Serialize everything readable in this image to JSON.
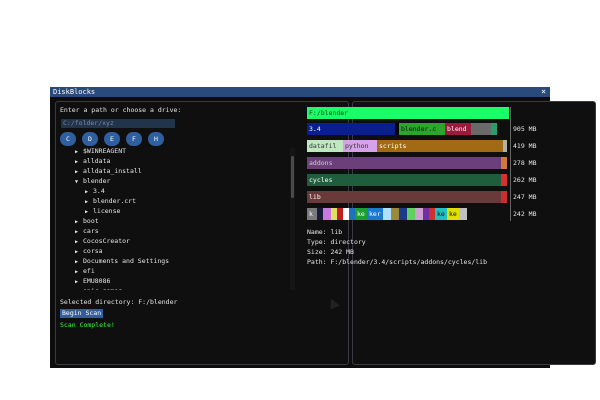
{
  "window": {
    "title": "DiskBlocks",
    "close": "×"
  },
  "left": {
    "prompt": "Enter a path or choose a drive:",
    "path_placeholder": "C:/folder/xyz",
    "drives": [
      "C",
      "D",
      "E",
      "F",
      "H"
    ],
    "tree": [
      {
        "label": "$WINREAGENT",
        "depth": 0,
        "expanded": false
      },
      {
        "label": "alldata",
        "depth": 0,
        "expanded": false
      },
      {
        "label": "alldata_install",
        "depth": 0,
        "expanded": false
      },
      {
        "label": "blender",
        "depth": 0,
        "expanded": true
      },
      {
        "label": "3.4",
        "depth": 1,
        "expanded": false
      },
      {
        "label": "blender.crt",
        "depth": 1,
        "expanded": false
      },
      {
        "label": "license",
        "depth": 1,
        "expanded": false
      },
      {
        "label": "boot",
        "depth": 0,
        "expanded": false
      },
      {
        "label": "cars",
        "depth": 0,
        "expanded": false
      },
      {
        "label": "CocosCreator",
        "depth": 0,
        "expanded": false
      },
      {
        "label": "corsa",
        "depth": 0,
        "expanded": false
      },
      {
        "label": "Documents and Settings",
        "depth": 0,
        "expanded": false
      },
      {
        "label": "efi",
        "depth": 0,
        "expanded": false
      },
      {
        "label": "EMU8086",
        "depth": 0,
        "expanded": false
      },
      {
        "label": "epic games",
        "depth": 0,
        "expanded": false
      }
    ],
    "selected": "Selected directory: F:/blender",
    "begin": "Begin Scan",
    "status": "Scan Complete!"
  },
  "right": {
    "root": "F:/blender",
    "rows": [
      {
        "size": "905 MB",
        "segments": [
          {
            "label": "3.4",
            "color": "#0a1f8f",
            "text": "#ffffff",
            "w": 88
          },
          {
            "label": "",
            "color": "#000000",
            "w": 4
          },
          {
            "label": "blender.c",
            "color": "#2aa62a",
            "text": "#111111",
            "w": 46
          },
          {
            "label": "blend",
            "color": "#9b1b3c",
            "text": "#ffffff",
            "w": 26
          },
          {
            "label": "",
            "color": "#6a6a6a",
            "w": 20
          },
          {
            "label": "",
            "color": "#2b9b6b",
            "w": 6
          }
        ]
      },
      {
        "size": "419 MB",
        "segments": [
          {
            "label": "datafil",
            "color": "#bfe7c0",
            "text": "#333333",
            "w": 36
          },
          {
            "label": "python",
            "color": "#d6a2e8",
            "text": "#333333",
            "w": 34
          },
          {
            "label": "scripts",
            "color": "#a36a16",
            "text": "#ffffff",
            "w": 126
          },
          {
            "label": "",
            "color": "#b0b0b0",
            "w": 4
          }
        ]
      },
      {
        "size": "278 MB",
        "segments": [
          {
            "label": "addons",
            "color": "#6a3f7a",
            "text": "#cfcfcf",
            "w": 194
          },
          {
            "label": "",
            "color": "#d07a3a",
            "w": 6
          }
        ]
      },
      {
        "size": "262 MB",
        "segments": [
          {
            "label": "cycles",
            "color": "#1e5e3c",
            "text": "#ffffff",
            "w": 194
          },
          {
            "label": "",
            "color": "#d83030",
            "w": 6
          }
        ]
      },
      {
        "size": "247 MB",
        "segments": [
          {
            "label": "lib",
            "color": "#6a3a3a",
            "text": "#ffffff",
            "w": 194
          },
          {
            "label": "",
            "color": "#c83030",
            "w": 6
          }
        ]
      },
      {
        "size": "242 MB",
        "segments": [
          {
            "label": "k",
            "color": "#7a7a7a",
            "text": "#ffffff",
            "w": 10
          },
          {
            "label": "",
            "color": "#1a1a3a",
            "w": 6
          },
          {
            "label": "",
            "color": "#c87ae0",
            "w": 8
          },
          {
            "label": "",
            "color": "#e0e060",
            "w": 6
          },
          {
            "label": "",
            "color": "#c02020",
            "w": 6
          },
          {
            "label": "",
            "color": "#ffffff",
            "w": 6
          },
          {
            "label": "",
            "color": "#2070c0",
            "w": 6
          },
          {
            "label": "ke",
            "color": "#1aa030",
            "text": "#ffffff",
            "w": 12
          },
          {
            "label": "ker",
            "color": "#1a7ad0",
            "text": "#ffffff",
            "w": 16
          },
          {
            "label": "",
            "color": "#b0e0ff",
            "w": 8
          },
          {
            "label": "",
            "color": "#9a8a3a",
            "w": 8
          },
          {
            "label": "",
            "color": "#1a3a8a",
            "w": 8
          },
          {
            "label": "",
            "color": "#60d060",
            "w": 8
          },
          {
            "label": "",
            "color": "#d0a0d0",
            "w": 8
          },
          {
            "label": "",
            "color": "#7030a0",
            "w": 6
          },
          {
            "label": "",
            "color": "#d03030",
            "w": 6
          },
          {
            "label": "ke",
            "color": "#20c0c0",
            "text": "#111111",
            "w": 12
          },
          {
            "label": "ke",
            "color": "#e0e000",
            "text": "#111111",
            "w": 12
          },
          {
            "label": "",
            "color": "#c0c0c0",
            "w": 8
          }
        ]
      }
    ],
    "info": {
      "name": "Name: lib",
      "type": "Type: directory",
      "size": "Size: 242 MB",
      "path": "Path: F:/blender/3.4/scripts/addons/cycles/lib"
    }
  }
}
